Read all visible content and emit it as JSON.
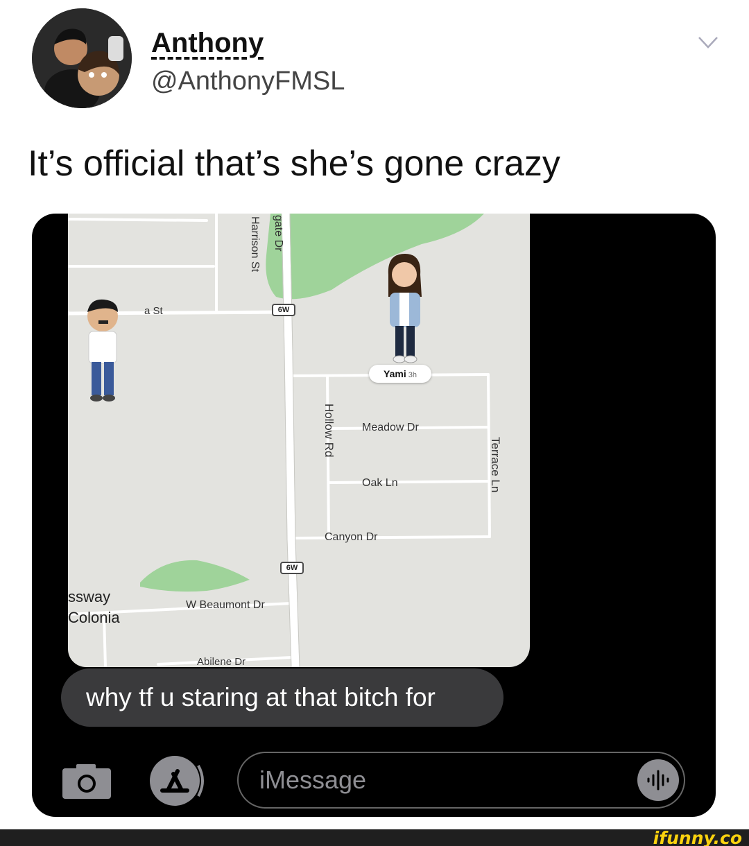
{
  "tweet": {
    "author_name": "Anthony",
    "author_handle": "@AnthonyFMSL",
    "text": "It’s official that’s she’s gone crazy",
    "menu_icon": "chevron-down-icon"
  },
  "map": {
    "streets": {
      "harrison": "Harrison St",
      "gate": "gate Dr",
      "a_st": "a St",
      "hollow": "Hollow Rd",
      "meadow": "Meadow Dr",
      "oak": "Oak Ln",
      "terrace": "Terrace Ln",
      "canyon": "Canyon Dr",
      "beaumont": "W Beaumont Dr",
      "abilene": "Abilene Dr"
    },
    "places": {
      "sway": "ssway",
      "colonia": "Colonia"
    },
    "route_shield": "6W",
    "friend": {
      "name": "Yami",
      "age": "3h"
    }
  },
  "conversation": {
    "message": "why tf u staring at that bitch for"
  },
  "input_bar": {
    "placeholder": "iMessage"
  },
  "watermark": "ifunny.co",
  "colors": {
    "map_bg": "#e3e3df",
    "park": "#9fd39a",
    "bubble": "#3a3a3c",
    "watermark": "#fbd20e"
  }
}
